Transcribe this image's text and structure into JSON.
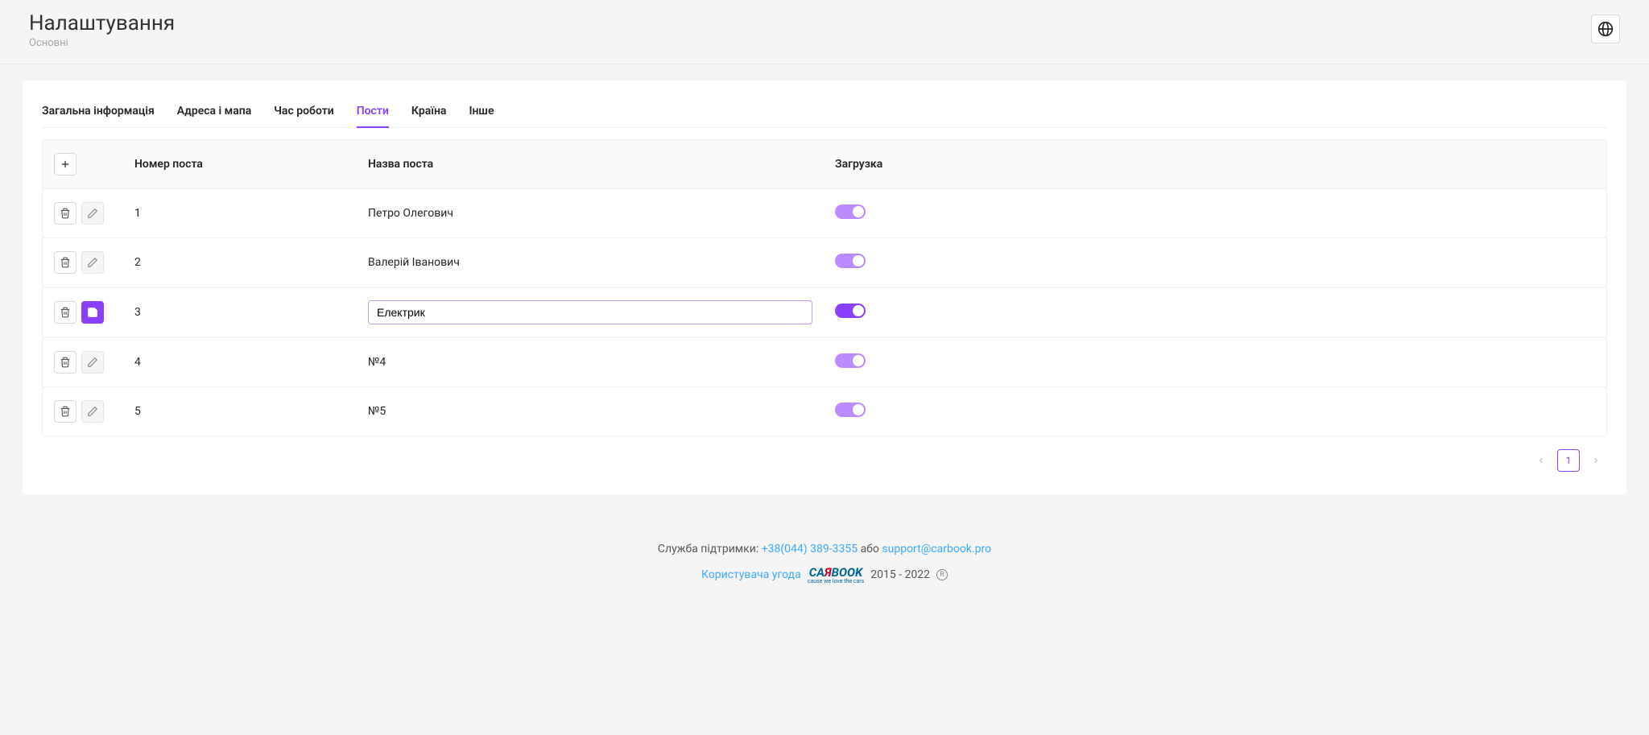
{
  "header": {
    "title": "Налаштування",
    "subtitle": "Основні"
  },
  "tabs": [
    {
      "id": "general",
      "label": "Загальна інформація",
      "active": false
    },
    {
      "id": "map",
      "label": "Адреса і мапа",
      "active": false
    },
    {
      "id": "hours",
      "label": "Час роботи",
      "active": false
    },
    {
      "id": "posts",
      "label": "Пости",
      "active": true
    },
    {
      "id": "country",
      "label": "Країна",
      "active": false
    },
    {
      "id": "other",
      "label": "Інше",
      "active": false
    }
  ],
  "table": {
    "cols": {
      "number": "Номер поста",
      "name": "Назва поста",
      "load": "Загрузка"
    },
    "rows": [
      {
        "num": "1",
        "name": "Петро Олегович",
        "editing": false,
        "on": true
      },
      {
        "num": "2",
        "name": "Валерій Іванович",
        "editing": false,
        "on": true
      },
      {
        "num": "3",
        "name": "Електрик",
        "editing": true,
        "on": true
      },
      {
        "num": "4",
        "name": "№4",
        "editing": false,
        "on": true
      },
      {
        "num": "5",
        "name": "№5",
        "editing": false,
        "on": true
      }
    ]
  },
  "pagination": {
    "current": "1"
  },
  "footer": {
    "support_label": "Служба підтримки:",
    "phone": "+38(044) 389-3355",
    "or": "або",
    "email": "support@carbook.pro",
    "terms": "Користувача угода",
    "logo_main": "CA",
    "logo_r": "Я",
    "logo_rest": "BOOK",
    "logo_tag": "cause we love the cars",
    "years": "2015 - 2022",
    "reg": "R"
  }
}
